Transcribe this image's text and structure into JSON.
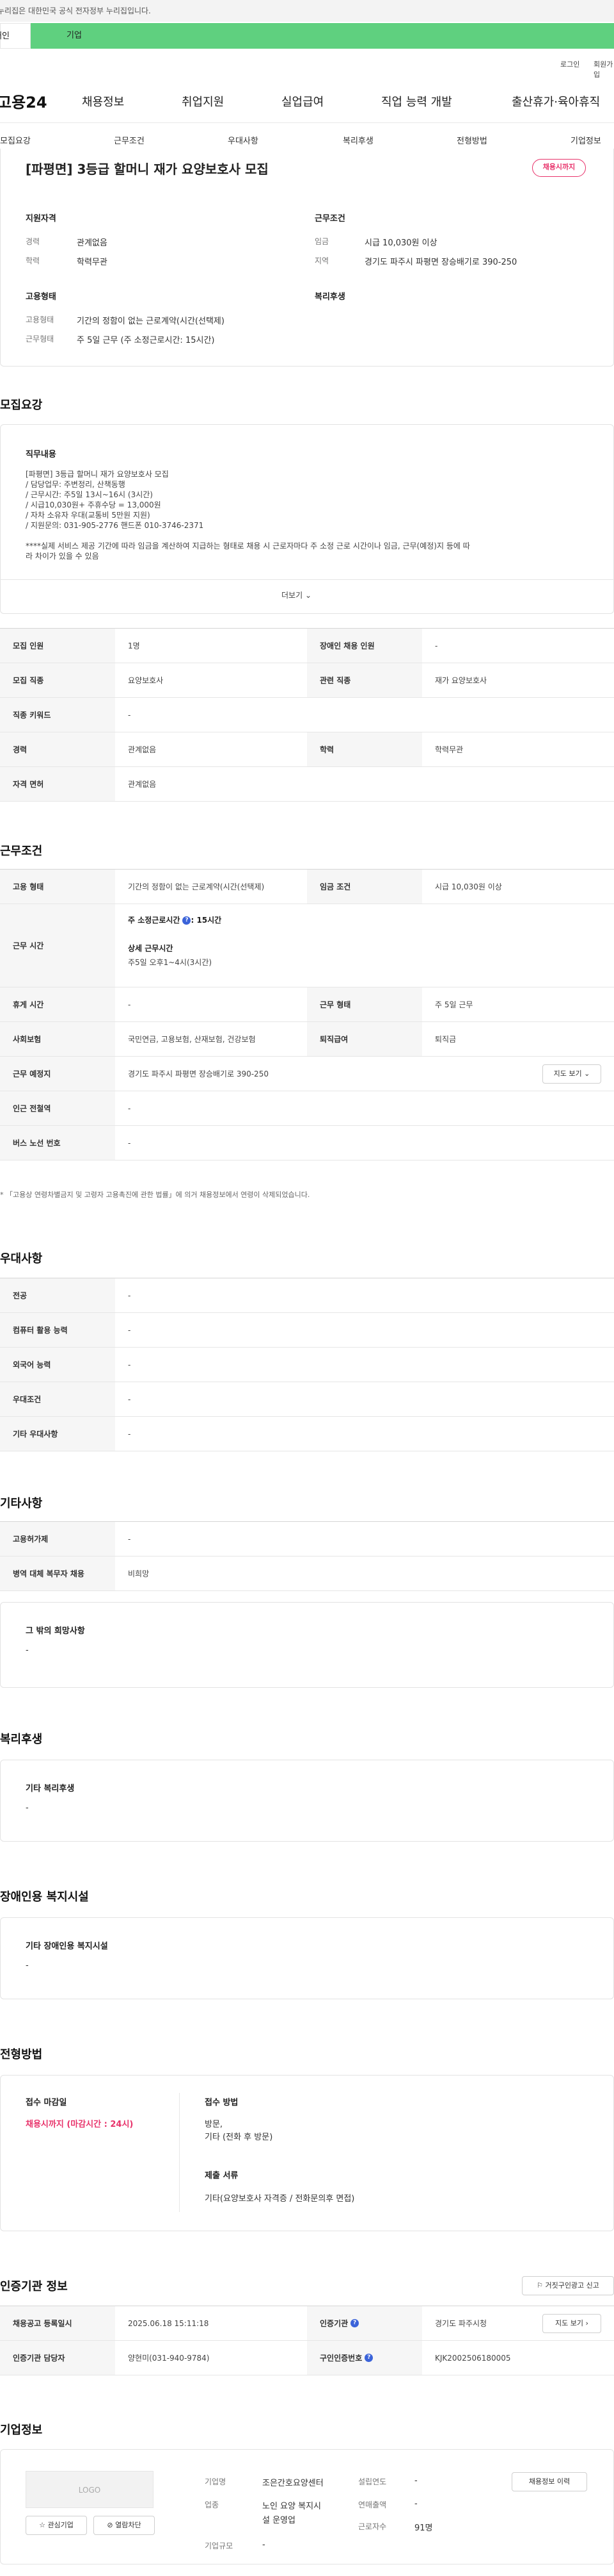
{
  "topbar": {
    "text": "누리집은 대한민국 공식 전자정부 누리집입니다."
  },
  "tabs": {
    "individual": "개인",
    "enterprise": "기업"
  },
  "util": {
    "login": "로그인",
    "join": "회원가입"
  },
  "logo": "고용24",
  "gnb": [
    "채용정보",
    "취업지원",
    "실업급여",
    "직업 능력 개발",
    "출산휴가·육아휴직"
  ],
  "lnb": [
    "모집요강",
    "근무조건",
    "우대사항",
    "복리후생",
    "전형방법",
    "기업정보"
  ],
  "summary": {
    "title": "[파평면] 3등급 할머니 재가 요양보호사 모집",
    "badge": "채용시까지",
    "qual_title": "지원자격",
    "cond_title": "근무조건",
    "career_l": "경력",
    "career_v": "관계없음",
    "edu_l": "학력",
    "edu_v": "학력무관",
    "wage_l": "임금",
    "wage_v": "시급 10,030원 이상",
    "region_l": "지역",
    "region_v": "경기도 파주시 파평면 장승배기로 390-250",
    "emp_title": "고용형태",
    "welfare_title": "복리후생",
    "emptype_l": "고용형태",
    "emptype_v": "기간의 정함이 없는 근로계약(시간(선택제)",
    "worktype_l": "근무형태",
    "worktype_v": "주 5일 근무 (주 소정근로시간: 15시간)"
  },
  "recruit": {
    "title": "모집요강",
    "job_title": "직무내용",
    "job_lines": [
      "[파평면] 3등급 할머니 재가 요양보호사 모집",
      "/ 담당업무: 주변정리, 산책동행",
      "/ 근무시간: 주5일 13시~16시 (3시간)",
      "/ 시급10,030원+ 주휴수당 = 13,000원",
      "/ 자차 소유자 우대(교통비 5만원 지원)",
      "/ 지원문의: 031-905-2776  핸드폰 010-3746-2371",
      "",
      "****실제 서비스 제공 기간에 따라 임금을 계산하여 지급하는 형태로 채용 시 근로자마다 주 소정 근로 시간이나 임금, 근무(예정)지 등에 따",
      "라 차이가 있을 수 있음"
    ],
    "more": "더보기",
    "rows": [
      {
        "l1": "모집 인원",
        "v1": "1명",
        "l2": "장애인 채용 인원",
        "v2": "-"
      },
      {
        "l1": "모집 직종",
        "v1": "요양보호사",
        "l2": "관련 직종",
        "v2": "재가 요양보호사"
      },
      {
        "l1": "직종 키워드",
        "v1": "-"
      },
      {
        "l1": "경력",
        "v1": "관계없음",
        "l2": "학력",
        "v2": "학력무관"
      },
      {
        "l1": "자격 면허",
        "v1": "관계없음"
      }
    ]
  },
  "work": {
    "title": "근무조건",
    "emp_l": "고용 형태",
    "emp_v": "기간의 정함이 없는 근로계약(시간(선택제)",
    "wage_l": "임금 조건",
    "wage_v": "시급 10,030원 이상",
    "time_l": "근무 시간",
    "weekly": "주 소정근로시간",
    "weekly_v": ": 15시간",
    "detail": "상세 근무시간",
    "detail_v": "주5일 오후1~4시(3시간)",
    "rest_l": "휴게 시간",
    "rest_v": "-",
    "form_l": "근무 형태",
    "form_v": "주 5일 근무",
    "ins_l": "사회보험",
    "ins_v": "국민연금, 고용보험, 산재보험, 건강보험",
    "ret_l": "퇴직급여",
    "ret_v": "퇴직금",
    "place_l": "근무 예정지",
    "place_v": "경기도 파주시 파평면 장승배기로 390-250",
    "map_btn": "지도 보기",
    "subway_l": "인근 전철역",
    "subway_v": "-",
    "bus_l": "버스 노선 번호",
    "bus_v": "-",
    "note": "* 「고용상 연령차별금지 및 고령자 고용촉진에 관한 법률」에 의거 채용정보에서 연령이 삭제되었습니다."
  },
  "pref": {
    "title": "우대사항",
    "rows": [
      {
        "l": "전공",
        "v": "-"
      },
      {
        "l": "컴퓨터 활용 능력",
        "v": "-"
      },
      {
        "l": "외국어 능력",
        "v": "-"
      },
      {
        "l": "우대조건",
        "v": "-"
      },
      {
        "l": "기타 우대사항",
        "v": "-"
      }
    ]
  },
  "etc": {
    "title": "기타사항",
    "rows": [
      {
        "l": "고용허가제",
        "v": "-"
      },
      {
        "l": "병역 대체 복무자 채용",
        "v": "비희망"
      }
    ],
    "box_title": "그 밖의 희망사항",
    "box_v": "-"
  },
  "welfare": {
    "title": "복리후생",
    "box_title": "기타 복리후생",
    "box_v": "-"
  },
  "disab": {
    "title": "장애인용 복지시설",
    "box_title": "기타 장애인용 복지시설",
    "box_v": "-"
  },
  "select": {
    "title": "전형방법",
    "deadline_l": "접수 마감일",
    "deadline_v": "채용시까지 (마감시간 : 24시)",
    "method_l": "접수 방법",
    "method_v1": "방문,",
    "method_v2": "기타 (전화 후 방문)",
    "docs_l": "제출 서류",
    "docs_v": "기타(요양보호사 자격증 / 전화문의후 면접)"
  },
  "cert": {
    "title": "인증기관 정보",
    "report_btn": "거짓구인광고 신고",
    "reg_l": "채용공고 등록일시",
    "reg_v": "2025.06.18 15:11:18",
    "org_l": "인증기관",
    "org_v": "경기도 파주시청",
    "map_btn": "지도 보기",
    "mgr_l": "인증기관 담당자",
    "mgr_v": "양현미(031-940-9784)",
    "num_l": "구인인증번호",
    "num_v": "KJK2002506180005"
  },
  "company": {
    "title": "기업정보",
    "logo": "LOGO",
    "fav": "관심기업",
    "block": "열람차단",
    "name_l": "기업명",
    "name_v": "조은간호요양센터",
    "ind_l": "업종",
    "ind_v1": "노인 요양 복지시",
    "ind_v2": "설 운영업",
    "size_l": "기업규모",
    "size_v": "-",
    "est_l": "설립연도",
    "est_v": "-",
    "rev_l": "연매출액",
    "rev_v": "-",
    "emp_l": "근로자수",
    "emp_v": "91명",
    "hist_btn": "채용정보 이력"
  }
}
